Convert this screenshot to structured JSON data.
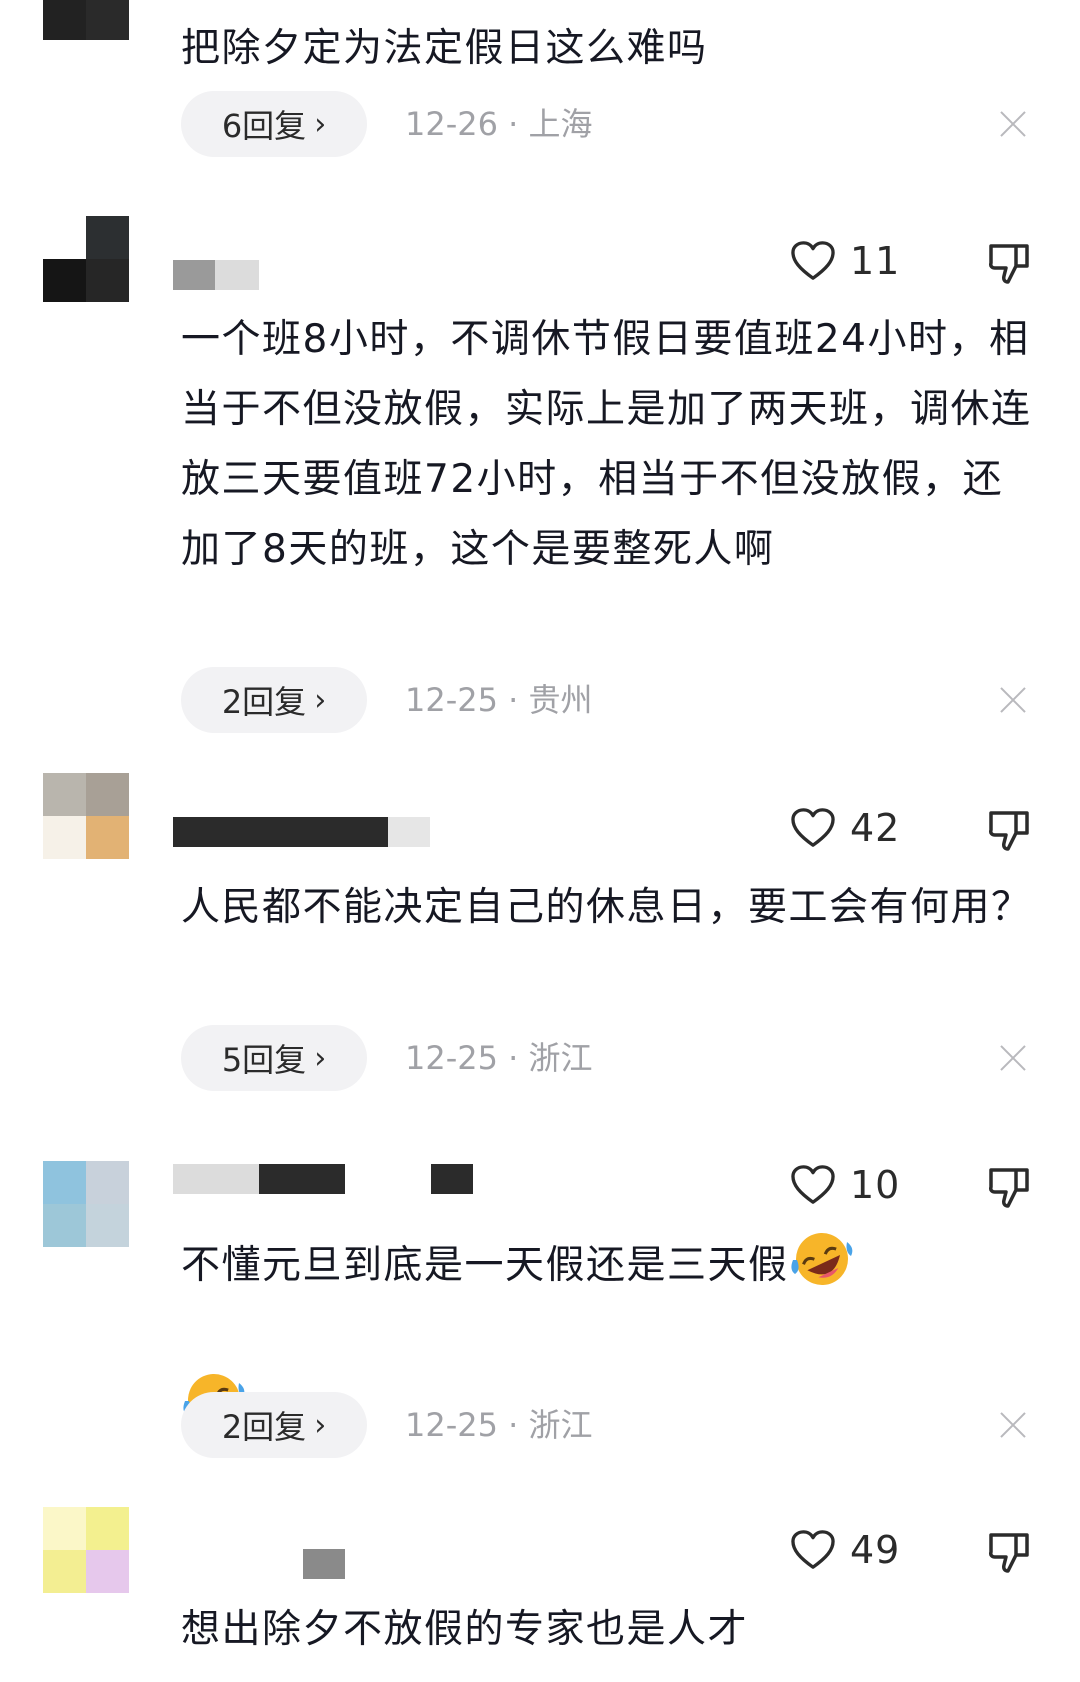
{
  "comments": [
    {
      "text": "把除夕定为法定假日这么难吗",
      "reply_label": "6回复",
      "meta": "12-26 · 上海"
    },
    {
      "likes": "11",
      "text": "一个班8小时，不调休节假日要值班24小时，相当于不但没放假，实际上是加了两天班，调休连放三天要值班72小时，相当于不但没放假，还加了8天的班，这个是要整死人啊",
      "reply_label": "2回复",
      "meta": "12-25 · 贵州"
    },
    {
      "likes": "42",
      "text": "人民都不能决定自己的休息日，要工会有何用？",
      "reply_label": "5回复",
      "meta": "12-25 · 浙江"
    },
    {
      "likes": "10",
      "text": "不懂元旦到底是一天假还是三天假",
      "reply_label": "2回复",
      "meta": "12-25 · 浙江"
    },
    {
      "likes": "49",
      "text": "想出除夕不放假的专家也是人才"
    }
  ],
  "icons": {
    "like": "heart-outline-icon",
    "dislike": "thumbs-down-icon",
    "close": "close-icon",
    "reply_chevron": "chevron-right-icon",
    "emoji": "rolling-on-floor-laughing-emoji"
  },
  "colors": {
    "text": "#161823",
    "meta": "#a0a1a6",
    "reply_bg": "#f2f2f4",
    "icon": "#2b2b2b"
  }
}
